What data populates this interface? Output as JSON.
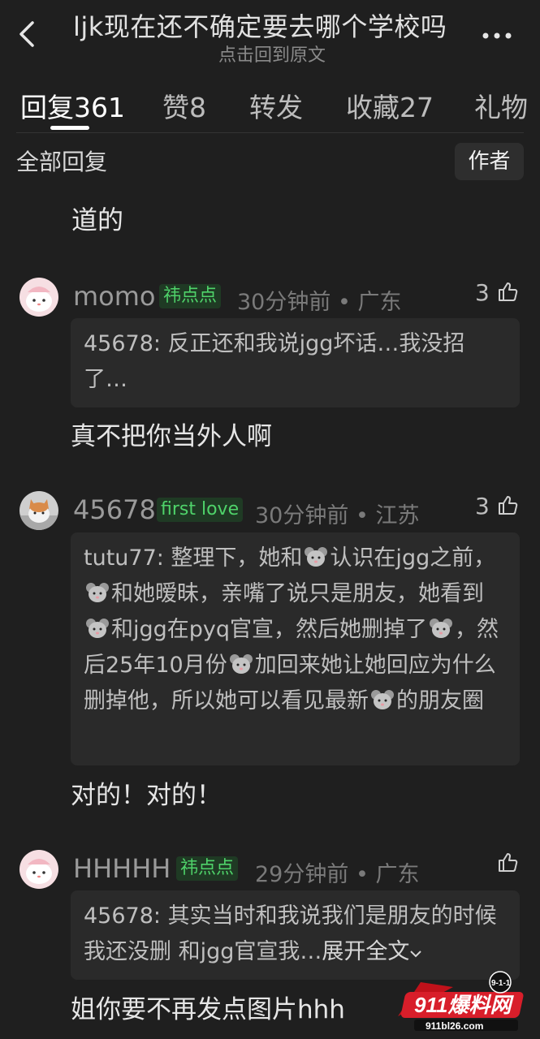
{
  "header": {
    "title": "ljk现在还不确定要去哪个学校吗",
    "subtitle": "点击回到原文"
  },
  "tabs": [
    {
      "label": "回复",
      "count": "361"
    },
    {
      "label": "赞",
      "count": "8"
    },
    {
      "label": "转发",
      "count": ""
    },
    {
      "label": "收藏",
      "count": "27"
    },
    {
      "label": "礼物",
      "count": ""
    }
  ],
  "filter": {
    "label": "全部回复",
    "author_button": "作者"
  },
  "partial_text": "道的",
  "comments": [
    {
      "username": "momo",
      "badge": "祎点点",
      "meta": "30分钟前 • 广东",
      "likes": "3",
      "quote": "45678: 反正还和我说jgg坏话…我没招了…",
      "body": "真不把你当外人啊"
    },
    {
      "username": "45678",
      "badge": "first love",
      "meta": "30分钟前 • 江苏",
      "likes": "3",
      "quote_parts": [
        "tutu77: 整理下，她和",
        "认识在jgg之前，",
        "和她暧昧，亲嘴了说只是朋友，她看到",
        "和jgg在pyq官宣，然后她删掉了",
        "，然后25年10月份",
        "加回来她让她回应为什么删掉他，所以她可以看见最新",
        "的朋友圈"
      ],
      "body": "对的！对的！"
    },
    {
      "username": "HHHHH",
      "badge": "祎点点",
      "meta": "29分钟前 • 广东",
      "likes": "",
      "quote": "45678: 其实当时和我说我们是朋友的时候我还没删 和jgg官宣我…",
      "expand": "展开全文",
      "body": "姐你要不再发点图片hhh"
    }
  ],
  "watermark": {
    "brand": "911爆料网",
    "url": "911bl26.com",
    "tag": "9-1-1"
  },
  "colors": {
    "background": "#1f1f1f",
    "badge_green": "#4fd36a",
    "quote_bg": "#2a2a2a"
  }
}
